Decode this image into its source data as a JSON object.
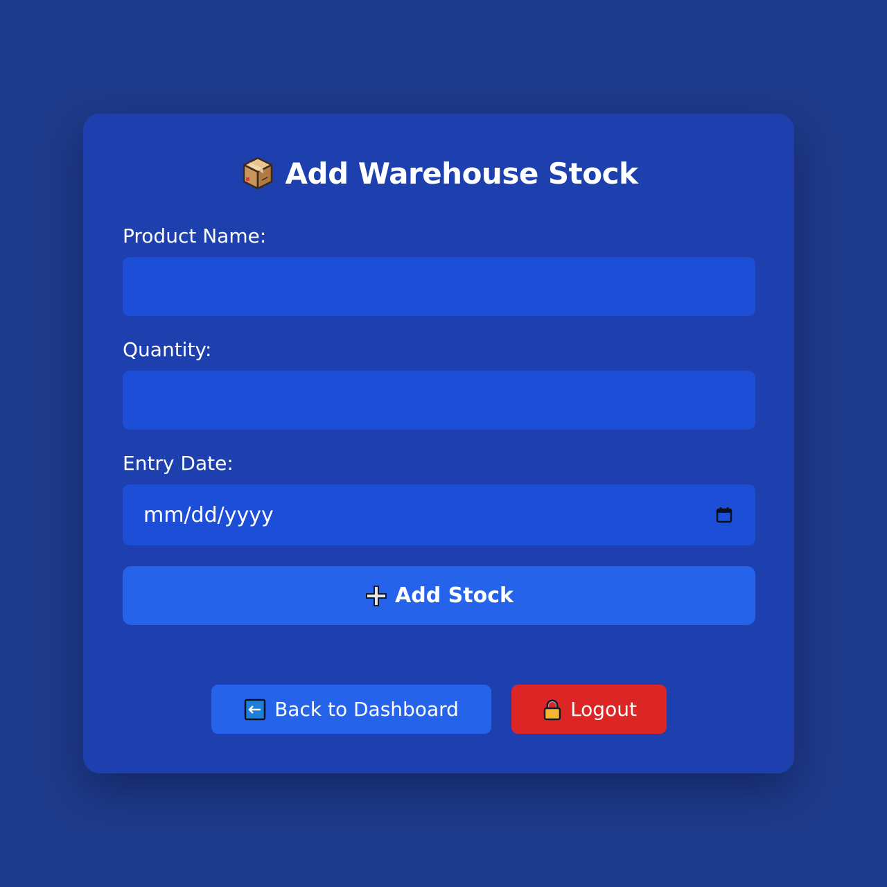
{
  "page": {
    "title": "Add Warehouse Stock",
    "title_icon": "package-icon"
  },
  "form": {
    "product_name_label": "Product Name:",
    "product_name_value": "",
    "quantity_label": "Quantity:",
    "quantity_value": "",
    "entry_date_label": "Entry Date:",
    "entry_date_placeholder": "mm/dd/yyyy",
    "entry_date_icon": "calendar-icon",
    "submit_label": "Add Stock",
    "submit_icon": "plus-icon"
  },
  "actions": {
    "back_label": "Back to Dashboard",
    "back_icon": "left-arrow-icon",
    "logout_label": "Logout",
    "logout_icon": "lock-icon"
  },
  "colors": {
    "background": "#1e3a8a",
    "card": "#1e40af",
    "input": "#1d4ed8",
    "primary_button": "#2563eb",
    "logout_button": "#dc2626"
  }
}
